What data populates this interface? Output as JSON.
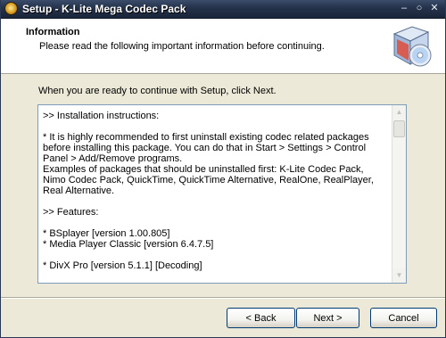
{
  "window": {
    "title": "Setup - K-Lite Mega Codec Pack"
  },
  "header": {
    "title": "Information",
    "subtitle": "Please read the following important information before continuing."
  },
  "body": {
    "intro": "When you are ready to continue with Setup, click Next.",
    "memo_text": ">> Installation instructions:\n\n* It is highly recommended to first uninstall existing codec related packages before installing this package. You can do that in Start > Settings > Control Panel > Add/Remove programs.\nExamples of packages that should be uninstalled first: K-Lite Codec Pack, Nimo Codec Pack, QuickTime, QuickTime Alternative, RealOne, RealPlayer, Real Alternative.\n\n>> Features:\n\n* BSplayer [version 1.00.805]\n* Media Player Classic [version 6.4.7.5]\n\n* DivX Pro [version 5.1.1] [Decoding]"
  },
  "buttons": {
    "back": "< Back",
    "next": "Next >",
    "cancel": "Cancel"
  },
  "titlebar_buttons": {
    "minimize": "–",
    "maximize": "○",
    "close": "✕"
  }
}
